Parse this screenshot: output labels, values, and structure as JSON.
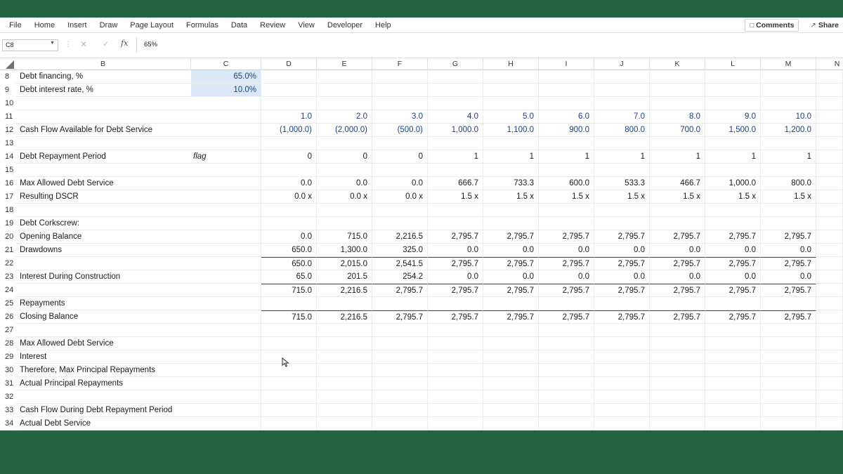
{
  "menu": [
    "File",
    "Home",
    "Insert",
    "Draw",
    "Page Layout",
    "Formulas",
    "Data",
    "Review",
    "View",
    "Developer",
    "Help"
  ],
  "buttons": {
    "comments": "Comments",
    "share": "Share"
  },
  "formula_bar": {
    "cell_ref": "C8",
    "content": "65%"
  },
  "columns": [
    "B",
    "C",
    "D",
    "E",
    "F",
    "G",
    "H",
    "I",
    "J",
    "K",
    "L",
    "M",
    "N"
  ],
  "rows": [
    {
      "n": "8",
      "label": "Debt financing, %",
      "c": "65.0%"
    },
    {
      "n": "9",
      "label": "Debt interest rate, %",
      "c": "10.0%"
    },
    {
      "n": "10",
      "label": ""
    },
    {
      "n": "11",
      "label": "",
      "vals": [
        "1.0",
        "2.0",
        "3.0",
        "4.0",
        "5.0",
        "6.0",
        "7.0",
        "8.0",
        "9.0",
        "10.0"
      ],
      "color": "blue"
    },
    {
      "n": "12",
      "label": "Cash Flow Available for Debt Service",
      "vals": [
        "(1,000.0)",
        "(2,000.0)",
        "(500.0)",
        "1,000.0",
        "1,100.0",
        "900.0",
        "800.0",
        "700.0",
        "1,500.0",
        "1,200.0"
      ],
      "color": "blue"
    },
    {
      "n": "13",
      "label": ""
    },
    {
      "n": "14",
      "label": "Debt Repayment Period",
      "c": "flag",
      "vals": [
        "0",
        "0",
        "0",
        "1",
        "1",
        "1",
        "1",
        "1",
        "1",
        "1"
      ],
      "color": "black"
    },
    {
      "n": "15",
      "label": ""
    },
    {
      "n": "16",
      "label": "Max Allowed Debt Service",
      "vals": [
        "0.0",
        "0.0",
        "0.0",
        "666.7",
        "733.3",
        "600.0",
        "533.3",
        "466.7",
        "1,000.0",
        "800.0"
      ],
      "color": "black"
    },
    {
      "n": "17",
      "label": "Resulting DSCR",
      "vals": [
        "0.0 x",
        "0.0 x",
        "0.0 x",
        "1.5 x",
        "1.5 x",
        "1.5 x",
        "1.5 x",
        "1.5 x",
        "1.5 x",
        "1.5 x"
      ],
      "color": "black"
    },
    {
      "n": "18",
      "label": ""
    },
    {
      "n": "19",
      "label": "Debt Corkscrew:"
    },
    {
      "n": "20",
      "label": "Opening Balance",
      "vals": [
        "0.0",
        "715.0",
        "2,216.5",
        "2,795.7",
        "2,795.7",
        "2,795.7",
        "2,795.7",
        "2,795.7",
        "2,795.7",
        "2,795.7"
      ],
      "color": "black"
    },
    {
      "n": "21",
      "label": "Drawdowns",
      "vals": [
        "650.0",
        "1,300.0",
        "325.0",
        "0.0",
        "0.0",
        "0.0",
        "0.0",
        "0.0",
        "0.0",
        "0.0"
      ],
      "color": "black"
    },
    {
      "n": "22",
      "label": "",
      "vals": [
        "650.0",
        "2,015.0",
        "2,541.5",
        "2,795.7",
        "2,795.7",
        "2,795.7",
        "2,795.7",
        "2,795.7",
        "2,795.7",
        "2,795.7"
      ],
      "color": "black",
      "topline": true
    },
    {
      "n": "23",
      "label": "Interest During Construction",
      "vals": [
        "65.0",
        "201.5",
        "254.2",
        "0.0",
        "0.0",
        "0.0",
        "0.0",
        "0.0",
        "0.0",
        "0.0"
      ],
      "color": "black"
    },
    {
      "n": "24",
      "label": "",
      "vals": [
        "715.0",
        "2,216.5",
        "2,795.7",
        "2,795.7",
        "2,795.7",
        "2,795.7",
        "2,795.7",
        "2,795.7",
        "2,795.7",
        "2,795.7"
      ],
      "color": "black",
      "topline": true
    },
    {
      "n": "25",
      "label": "Repayments"
    },
    {
      "n": "26",
      "label": "Closing Balance",
      "vals": [
        "715.0",
        "2,216.5",
        "2,795.7",
        "2,795.7",
        "2,795.7",
        "2,795.7",
        "2,795.7",
        "2,795.7",
        "2,795.7",
        "2,795.7"
      ],
      "color": "black",
      "topline": true
    },
    {
      "n": "27",
      "label": ""
    },
    {
      "n": "28",
      "label": "Max Allowed Debt Service"
    },
    {
      "n": "29",
      "label": "Interest"
    },
    {
      "n": "30",
      "label": "Therefore, Max Principal Repayments"
    },
    {
      "n": "31",
      "label": "Actual Principal Repayments"
    },
    {
      "n": "32",
      "label": ""
    },
    {
      "n": "33",
      "label": "Cash Flow During Debt Repayment Period"
    },
    {
      "n": "34",
      "label": "Actual Debt Service"
    }
  ]
}
